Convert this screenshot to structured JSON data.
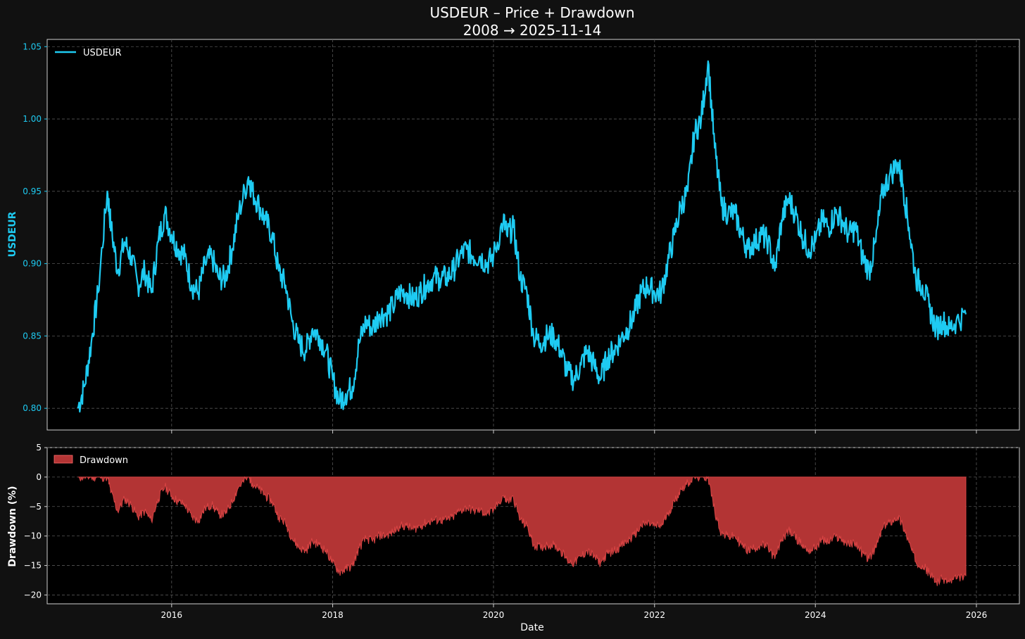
{
  "chart_data": [
    {
      "type": "line",
      "title": "USDEUR – Price + Drawdown",
      "subtitle": "2008 → 2025-11-14",
      "xlabel": "",
      "ylabel": "USDEUR",
      "ylim": [
        0.785,
        1.055
      ],
      "xlim": [
        "2014-06-15",
        "2026-07-15"
      ],
      "x_ticks": [
        "2016",
        "2018",
        "2020",
        "2022",
        "2024",
        "2026"
      ],
      "y_ticks": [
        "0.80",
        "0.85",
        "0.90",
        "0.95",
        "1.00",
        "1.05"
      ],
      "grid": true,
      "legend": "top-left",
      "color": "#1ecbf2",
      "series": [
        {
          "name": "USDEUR",
          "x": [
            "2014-11-01",
            "2014-12-01",
            "2015-01-01",
            "2015-02-01",
            "2015-03-15",
            "2015-04-01",
            "2015-05-01",
            "2015-06-01",
            "2015-07-01",
            "2015-08-01",
            "2015-09-01",
            "2015-10-01",
            "2015-11-01",
            "2015-12-01",
            "2016-01-01",
            "2016-02-01",
            "2016-03-01",
            "2016-04-01",
            "2016-05-01",
            "2016-06-01",
            "2016-07-01",
            "2016-08-01",
            "2016-09-01",
            "2016-10-01",
            "2016-11-01",
            "2016-12-15",
            "2017-01-01",
            "2017-02-01",
            "2017-03-01",
            "2017-04-01",
            "2017-05-01",
            "2017-06-01",
            "2017-07-01",
            "2017-08-01",
            "2017-09-01",
            "2017-10-01",
            "2017-11-01",
            "2017-12-01",
            "2018-01-01",
            "2018-02-01",
            "2018-03-01",
            "2018-04-01",
            "2018-05-01",
            "2018-06-01",
            "2018-07-01",
            "2018-08-01",
            "2018-09-01",
            "2018-10-01",
            "2018-11-01",
            "2018-12-01",
            "2019-01-01",
            "2019-02-01",
            "2019-03-01",
            "2019-04-01",
            "2019-05-01",
            "2019-06-01",
            "2019-07-01",
            "2019-08-01",
            "2019-09-01",
            "2019-10-01",
            "2019-11-01",
            "2019-12-01",
            "2020-01-01",
            "2020-02-15",
            "2020-03-01",
            "2020-04-01",
            "2020-05-01",
            "2020-06-01",
            "2020-07-01",
            "2020-08-01",
            "2020-09-01",
            "2020-10-01",
            "2020-11-01",
            "2020-12-01",
            "2021-01-01",
            "2021-02-01",
            "2021-03-01",
            "2021-04-01",
            "2021-05-01",
            "2021-06-01",
            "2021-07-01",
            "2021-08-01",
            "2021-09-01",
            "2021-10-01",
            "2021-11-01",
            "2021-12-01",
            "2022-01-01",
            "2022-02-01",
            "2022-03-01",
            "2022-04-01",
            "2022-05-01",
            "2022-06-01",
            "2022-07-01",
            "2022-08-01",
            "2022-09-01",
            "2022-10-01",
            "2022-11-01",
            "2022-12-01",
            "2023-01-01",
            "2023-02-01",
            "2023-03-01",
            "2023-04-01",
            "2023-05-01",
            "2023-06-01",
            "2023-07-01",
            "2023-08-01",
            "2023-09-01",
            "2023-10-01",
            "2023-11-01",
            "2023-12-01",
            "2024-01-01",
            "2024-02-01",
            "2024-03-01",
            "2024-04-01",
            "2024-05-01",
            "2024-06-01",
            "2024-07-01",
            "2024-08-01",
            "2024-09-01",
            "2024-10-01",
            "2024-11-01",
            "2024-12-01",
            "2025-01-10",
            "2025-02-01",
            "2025-03-01",
            "2025-04-01",
            "2025-05-01",
            "2025-06-01",
            "2025-07-01",
            "2025-08-01",
            "2025-09-01",
            "2025-10-01",
            "2025-11-14"
          ],
          "values": [
            0.8,
            0.815,
            0.845,
            0.88,
            0.95,
            0.925,
            0.895,
            0.915,
            0.905,
            0.885,
            0.895,
            0.88,
            0.915,
            0.935,
            0.92,
            0.91,
            0.905,
            0.885,
            0.88,
            0.9,
            0.905,
            0.89,
            0.89,
            0.91,
            0.935,
            0.96,
            0.95,
            0.94,
            0.93,
            0.92,
            0.895,
            0.885,
            0.86,
            0.845,
            0.84,
            0.855,
            0.85,
            0.84,
            0.82,
            0.805,
            0.81,
            0.815,
            0.845,
            0.86,
            0.855,
            0.865,
            0.865,
            0.87,
            0.88,
            0.88,
            0.875,
            0.88,
            0.885,
            0.89,
            0.89,
            0.89,
            0.895,
            0.905,
            0.91,
            0.905,
            0.905,
            0.9,
            0.905,
            0.93,
            0.92,
            0.925,
            0.89,
            0.88,
            0.85,
            0.845,
            0.85,
            0.85,
            0.84,
            0.825,
            0.82,
            0.83,
            0.84,
            0.83,
            0.82,
            0.835,
            0.84,
            0.848,
            0.855,
            0.865,
            0.88,
            0.885,
            0.88,
            0.88,
            0.9,
            0.92,
            0.94,
            0.95,
            0.99,
            1.0,
            1.04,
            0.98,
            0.94,
            0.935,
            0.935,
            0.92,
            0.91,
            0.915,
            0.92,
            0.915,
            0.895,
            0.93,
            0.945,
            0.935,
            0.92,
            0.91,
            0.915,
            0.93,
            0.925,
            0.935,
            0.93,
            0.92,
            0.925,
            0.905,
            0.895,
            0.915,
            0.95,
            0.96,
            0.97,
            0.955,
            0.925,
            0.89,
            0.885,
            0.87,
            0.855,
            0.86,
            0.855,
            0.86,
            0.865
          ]
        }
      ]
    },
    {
      "type": "area",
      "xlabel": "Date",
      "ylabel": "Drawdown (%)",
      "ylim": [
        -21.5,
        5
      ],
      "xlim": [
        "2014-06-15",
        "2026-07-15"
      ],
      "x_ticks": [
        "2016",
        "2018",
        "2020",
        "2022",
        "2024",
        "2026"
      ],
      "y_ticks": [
        "5",
        "0",
        "−5",
        "−10",
        "−15",
        "−20"
      ],
      "grid": true,
      "legend": "top-left",
      "color": "#b33434",
      "series": [
        {
          "name": "Drawdown",
          "x": [
            "2014-11-01",
            "2014-12-01",
            "2015-01-01",
            "2015-02-01",
            "2015-03-15",
            "2015-04-01",
            "2015-05-01",
            "2015-06-01",
            "2015-07-01",
            "2015-08-01",
            "2015-09-01",
            "2015-10-01",
            "2015-11-01",
            "2015-12-01",
            "2016-01-01",
            "2016-02-01",
            "2016-03-01",
            "2016-04-01",
            "2016-05-01",
            "2016-06-01",
            "2016-07-01",
            "2016-08-01",
            "2016-09-01",
            "2016-10-01",
            "2016-11-01",
            "2016-12-15",
            "2017-01-01",
            "2017-02-01",
            "2017-03-01",
            "2017-04-01",
            "2017-05-01",
            "2017-06-01",
            "2017-07-01",
            "2017-08-01",
            "2017-09-01",
            "2017-10-01",
            "2017-11-01",
            "2017-12-01",
            "2018-01-01",
            "2018-02-01",
            "2018-03-01",
            "2018-04-01",
            "2018-05-01",
            "2018-06-01",
            "2018-07-01",
            "2018-08-01",
            "2018-09-01",
            "2018-10-01",
            "2018-11-01",
            "2018-12-01",
            "2019-01-01",
            "2019-02-01",
            "2019-03-01",
            "2019-04-01",
            "2019-05-01",
            "2019-06-01",
            "2019-07-01",
            "2019-08-01",
            "2019-09-01",
            "2019-10-01",
            "2019-11-01",
            "2019-12-01",
            "2020-01-01",
            "2020-02-15",
            "2020-03-01",
            "2020-04-01",
            "2020-05-01",
            "2020-06-01",
            "2020-07-01",
            "2020-08-01",
            "2020-09-01",
            "2020-10-01",
            "2020-11-01",
            "2020-12-01",
            "2021-01-01",
            "2021-02-01",
            "2021-03-01",
            "2021-04-01",
            "2021-05-01",
            "2021-06-01",
            "2021-07-01",
            "2021-08-01",
            "2021-09-01",
            "2021-10-01",
            "2021-11-01",
            "2021-12-01",
            "2022-01-01",
            "2022-02-01",
            "2022-03-01",
            "2022-04-01",
            "2022-05-01",
            "2022-06-01",
            "2022-07-01",
            "2022-08-01",
            "2022-09-01",
            "2022-10-01",
            "2022-11-01",
            "2022-12-01",
            "2023-01-01",
            "2023-02-01",
            "2023-03-01",
            "2023-04-01",
            "2023-05-01",
            "2023-06-01",
            "2023-07-01",
            "2023-08-01",
            "2023-09-01",
            "2023-10-01",
            "2023-11-01",
            "2023-12-01",
            "2024-01-01",
            "2024-02-01",
            "2024-03-01",
            "2024-04-01",
            "2024-05-01",
            "2024-06-01",
            "2024-07-01",
            "2024-08-01",
            "2024-09-01",
            "2024-10-01",
            "2024-11-01",
            "2024-12-01",
            "2025-01-10",
            "2025-02-01",
            "2025-03-01",
            "2025-04-01",
            "2025-05-01",
            "2025-06-01",
            "2025-07-01",
            "2025-08-01",
            "2025-09-01",
            "2025-10-01",
            "2025-11-14"
          ],
          "values": [
            0,
            0,
            0,
            0,
            0,
            -2.6,
            -5.8,
            -3.7,
            -4.7,
            -6.8,
            -5.8,
            -7.4,
            -3.7,
            -1.6,
            -3.2,
            -4.2,
            -4.7,
            -6.8,
            -7.4,
            -5.3,
            -4.7,
            -6.3,
            -6.3,
            -4.2,
            -1.6,
            0,
            -1.0,
            -2.1,
            -3.1,
            -4.2,
            -6.8,
            -7.8,
            -10.4,
            -12.0,
            -12.5,
            -10.9,
            -11.5,
            -12.5,
            -14.6,
            -16.1,
            -15.6,
            -15.1,
            -12.0,
            -10.4,
            -10.9,
            -9.9,
            -9.9,
            -9.4,
            -8.3,
            -8.3,
            -8.9,
            -8.3,
            -7.8,
            -7.3,
            -7.3,
            -7.3,
            -6.8,
            -5.7,
            -5.2,
            -5.7,
            -5.7,
            -6.3,
            -5.7,
            -3.1,
            -4.2,
            -3.6,
            -7.3,
            -8.3,
            -11.5,
            -12.0,
            -11.5,
            -11.5,
            -12.5,
            -14.1,
            -14.6,
            -13.5,
            -12.5,
            -13.5,
            -14.6,
            -13.0,
            -12.5,
            -11.7,
            -10.9,
            -9.9,
            -8.3,
            -7.8,
            -8.3,
            -8.3,
            -6.3,
            -4.2,
            -2.1,
            -1.0,
            0,
            0,
            0,
            -5.8,
            -9.6,
            -10.1,
            -10.1,
            -11.5,
            -12.5,
            -12.0,
            -11.5,
            -12.0,
            -13.9,
            -10.6,
            -9.1,
            -10.1,
            -11.5,
            -12.5,
            -12.0,
            -10.6,
            -11.1,
            -10.1,
            -10.6,
            -11.5,
            -11.1,
            -13.0,
            -13.9,
            -12.0,
            -8.7,
            -7.7,
            -6.7,
            -8.2,
            -11.1,
            -14.4,
            -14.9,
            -16.3,
            -17.8,
            -17.3,
            -17.8,
            -17.3,
            -16.8
          ]
        }
      ]
    }
  ]
}
